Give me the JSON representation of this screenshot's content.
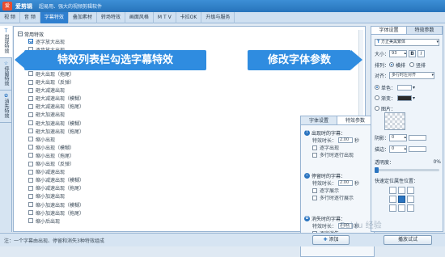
{
  "app": {
    "logo_text": "爱",
    "name": "爱剪辑",
    "slogan": "超易用、强大的视频剪辑软件"
  },
  "menu": [
    "视 频",
    "音 频",
    "字幕特效",
    "叠加素材",
    "转场特效",
    "画面风格",
    "M T V",
    "卡拉OK",
    "升级与服务"
  ],
  "menu_active": 2,
  "vtabs": [
    {
      "icon": "T",
      "label": "出现特效",
      "active": true
    },
    {
      "icon": "☆",
      "label": "停留特效",
      "active": false
    },
    {
      "icon": "✿",
      "label": "消失特效",
      "active": false
    }
  ],
  "effect_list": {
    "root_label": "常用特效",
    "items": [
      "逐字放大出现",
      "逐步放大出现",
      "砸大出现",
      "砸大出现（模糊）",
      "砸大出现（拖尾）",
      "砸大出现（反弹）",
      "砸大减速出现",
      "砸大减速出现（模糊）",
      "砸大减速出现（拖尾）",
      "砸大加速出现",
      "砸大加速出现（模糊）",
      "砸大加速出现（拖尾）",
      "缩小出现",
      "缩小出现（模糊）",
      "缩小出现（拖尾）",
      "缩小出现（反弹）",
      "缩小减速出现",
      "缩小减速出现（模糊）",
      "缩小减速出现（拖尾）",
      "缩小加速出现",
      "缩小加速出现（模糊）",
      "缩小加速出现（拖尾）",
      "缩小后出现"
    ],
    "checked_index": 0
  },
  "sub_panel": {
    "tabs": [
      "字体设置",
      "特效参数"
    ],
    "active_tab": 1,
    "sections": [
      {
        "icon": "T",
        "title": "出现时的字幕：",
        "duration_label": "特效时长：",
        "duration_value": "2.00",
        "unit": "秒",
        "options": [
          "逐字出现",
          "多行时逐行出现"
        ]
      },
      {
        "icon": "☆",
        "title": "停留时的字幕：",
        "duration_label": "特效时长：",
        "duration_value": "2.00",
        "unit": "秒",
        "options": [
          "逐字展示",
          "多行时逐行展示"
        ]
      },
      {
        "icon": "✿",
        "title": "消失时的字幕：",
        "duration_label": "特效时长：",
        "duration_value": "2.00",
        "unit": "秒",
        "options": [
          "逐字消失",
          "多行时逐行消失"
        ]
      }
    ]
  },
  "font_panel": {
    "tabs": [
      "字体设置",
      "特效参数"
    ],
    "active_tab": 0,
    "font_name": "方正美黑繁体",
    "size_label": "大小：",
    "size_value": "93",
    "bold": "B",
    "italic": "I",
    "arrange_label": "排列：",
    "arrange_options": [
      "横排",
      "竖排"
    ],
    "align_label": "对齐：",
    "align_value": "多行时左对齐",
    "fill_options": [
      "单色：",
      "渐变：",
      "图片："
    ],
    "shadow_label": "阴影：",
    "shadow_value": "0",
    "stroke_label": "描边：",
    "stroke_value": "0",
    "opacity_label": "透明度：",
    "opacity_value": "0%",
    "quickpos_label": "快速定位属性位置：",
    "quickpos_selected": 4
  },
  "callouts": {
    "left": "特效列表栏勾选字幕特效",
    "right": "修改字体参数"
  },
  "status": {
    "text": "注：一个字幕由出现、停留和消失3种特效组成",
    "add_button": "添加",
    "preview_button": "播放试试"
  },
  "watermark": "Baidu 经验",
  "colors": {
    "accent": "#2f7fcf",
    "callout": "#2f8ce0",
    "fill_single": "#ffffff",
    "fill_gradient": "#2a2a2a"
  }
}
